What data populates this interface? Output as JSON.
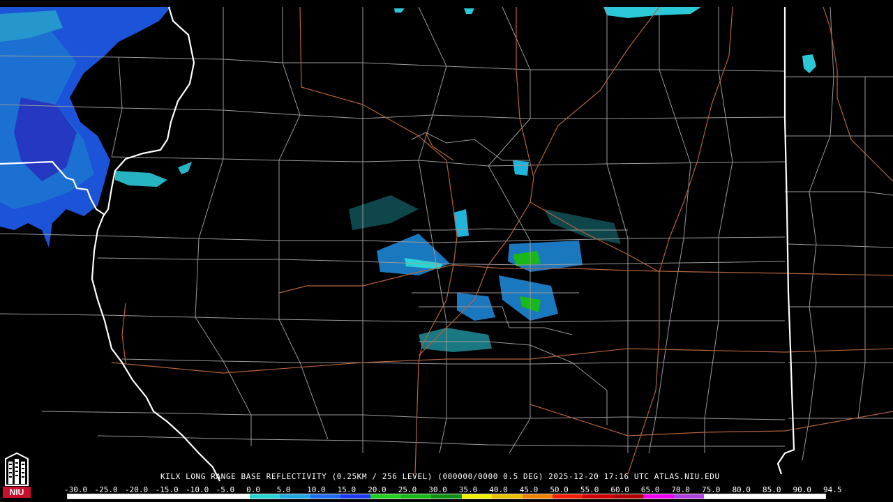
{
  "product": {
    "station": "KILX",
    "caption": "KILX LONG RANGE BASE REFLECTIVITY (0.25KM / 256 LEVEL) (000000/0000 0.5 DEG) 2025-12-20 17:16 UTC  ATLAS.NIU.EDU",
    "timestamp": "2025-12-20 17:16 UTC",
    "source": "ATLAS.NIU.EDU"
  },
  "legend": {
    "labels": [
      "-30.0",
      "-25.0",
      "-20.0",
      "-15.0",
      "-10.0",
      "-5.0",
      "0.0",
      "5.0",
      "10.0",
      "15.0",
      "20.0",
      "25.0",
      "30.0",
      "35.0",
      "40.0",
      "45.0",
      "50.0",
      "55.0",
      "60.0",
      "65.0",
      "70.0",
      "75.0",
      "80.0",
      "85.0",
      "90.0",
      "94.5"
    ],
    "colors": [
      "#ffffff",
      "#ffffff",
      "#ffffff",
      "#ffffff",
      "#ffffff",
      "#ffffff",
      "#2bd4d4",
      "#20a6e0",
      "#1e6ef0",
      "#1e3cf5",
      "#20d020",
      "#18b818",
      "#109010",
      "#f0f000",
      "#e8c000",
      "#f08000",
      "#f02000",
      "#d00000",
      "#b00000",
      "#f000f0",
      "#b040e0",
      "#ffffff",
      "#ffffff",
      "#ffffff",
      "#ffffff"
    ]
  },
  "logo": {
    "text": "NIU",
    "color": "#c8102e"
  },
  "map": {
    "background": "#000000",
    "county_color": "#9a9a9a",
    "state_color": "#ffffff",
    "road_color": "#b4643c"
  }
}
